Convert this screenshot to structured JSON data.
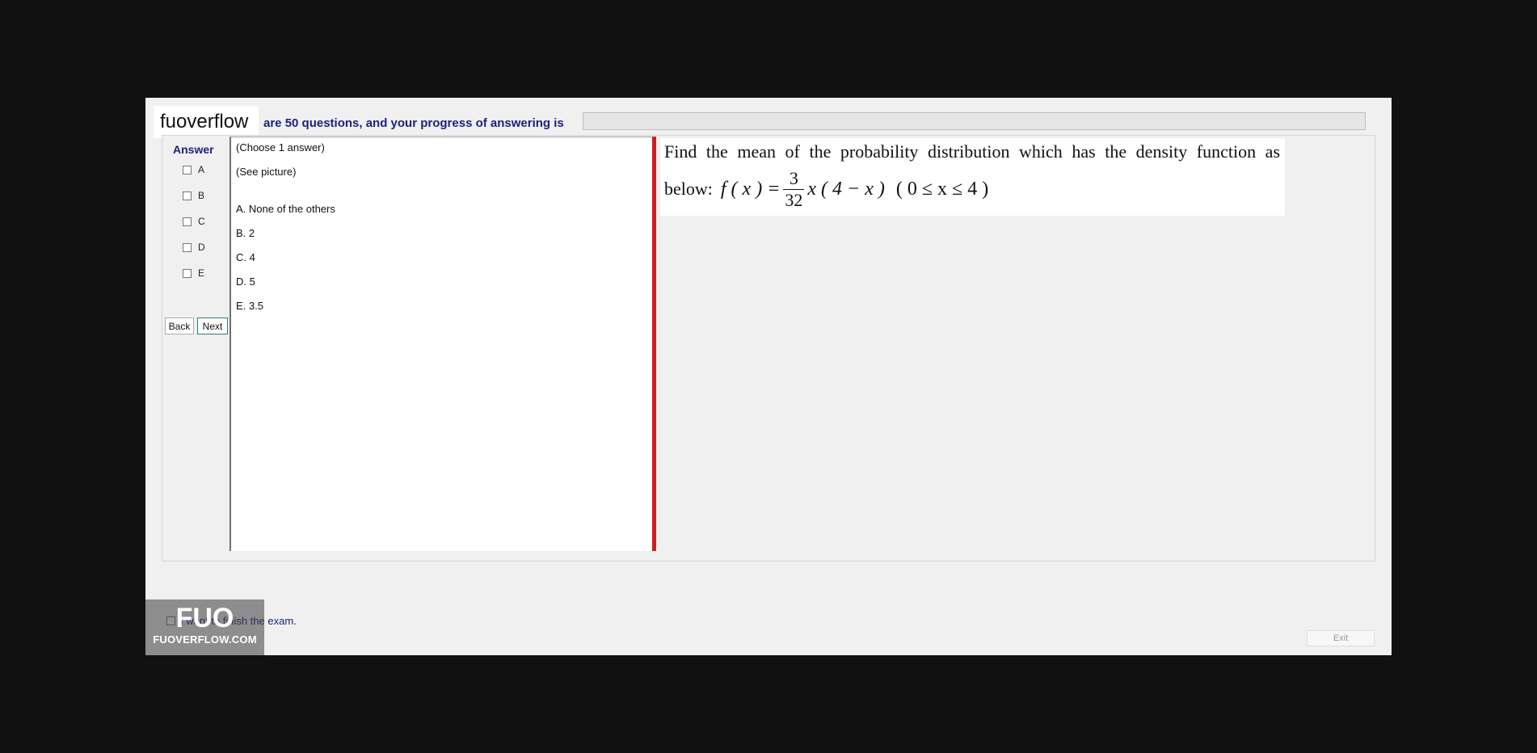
{
  "header": {
    "brand": "fuoverflow",
    "progress_label": "are 50 questions, and your progress of answering is",
    "progress_fraction": 0.0
  },
  "answer_panel": {
    "heading": "Answer",
    "options": [
      "A",
      "B",
      "C",
      "D",
      "E"
    ],
    "back_label": "Back",
    "next_label": "Next"
  },
  "choices": {
    "instruction": "(Choose 1 answer)",
    "see_picture": "(See picture)",
    "items": [
      "A.  None of the others",
      "B.  2",
      "C.  4",
      "D.  5",
      "E.  3.5"
    ]
  },
  "question": {
    "text": "Find the mean of the probability distribution which has the density function as",
    "formula_prefix": "below:",
    "formula_lhs": "f ( x ) =",
    "formula_num": "3",
    "formula_den": "32",
    "formula_rhs": "x ( 4 − x )",
    "formula_domain": "( 0 ≤ x ≤ 4 )"
  },
  "footer": {
    "finish_label": "I want to finish the exam.",
    "exit_label": "Exit",
    "logo_mark": "FUO",
    "logo_text": "FUOVERFLOW.COM"
  },
  "colors": {
    "accent_text": "#1a237e",
    "divider": "#cc1f1f"
  }
}
